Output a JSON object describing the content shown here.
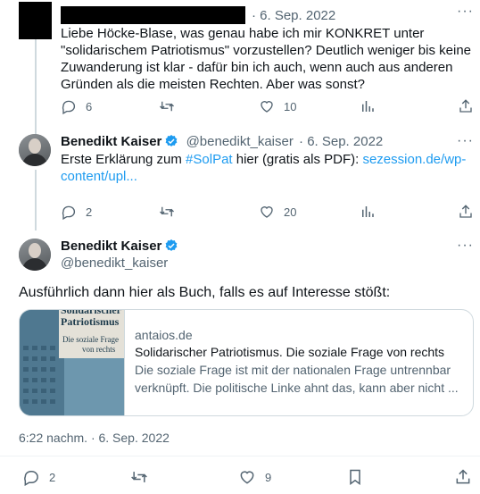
{
  "tweet1": {
    "date": "· 6. Sep. 2022",
    "text_lines": [
      "Liebe Höcke-Blase, was genau habe ich mir KONKRET unter",
      "\"solidarischem Patriotismus\" vorzustellen? Deutlich weniger bis keine",
      "Zuwanderung ist klar - dafür bin ich auch, wenn auch aus anderen",
      "Gründen als die meisten Rechten. Aber was sonst?"
    ],
    "replies": "6",
    "likes": "10"
  },
  "tweet2": {
    "name": "Benedikt Kaiser",
    "handle": "@benedikt_kaiser",
    "date": "· 6. Sep. 2022",
    "text_prefix": "Erste Erklärung zum ",
    "hashtag": "#SolPat",
    "text_mid": " hier (gratis als PDF): ",
    "link_part1": "sezession.de/wp-",
    "link_part2": "content/upl...",
    "replies": "2",
    "likes": "20"
  },
  "main": {
    "name": "Benedikt Kaiser",
    "handle": "@benedikt_kaiser",
    "text": "Ausführlich dann hier als Buch, falls es auf Interesse stößt:",
    "card": {
      "image_title_top": "Solidarischer",
      "image_title": "Patriotismus",
      "image_subtitle_1": "Die soziale Frage",
      "image_subtitle_2": "von rechts",
      "domain": "antaios.de",
      "title": "Solidarischer Patriotismus. Die soziale Frage von rechts",
      "desc_1": "Die soziale Frage ist mit der nationalen Frage untrennbar",
      "desc_2": "verknüpft. Die politische Linke ahnt das, kann aber nicht ..."
    },
    "timestamp": "6:22 nachm. · 6. Sep. 2022",
    "replies": "2",
    "likes": "9"
  },
  "colors": {
    "accent": "#1d9bf0",
    "muted": "#536471",
    "line": "#cfd9de"
  }
}
